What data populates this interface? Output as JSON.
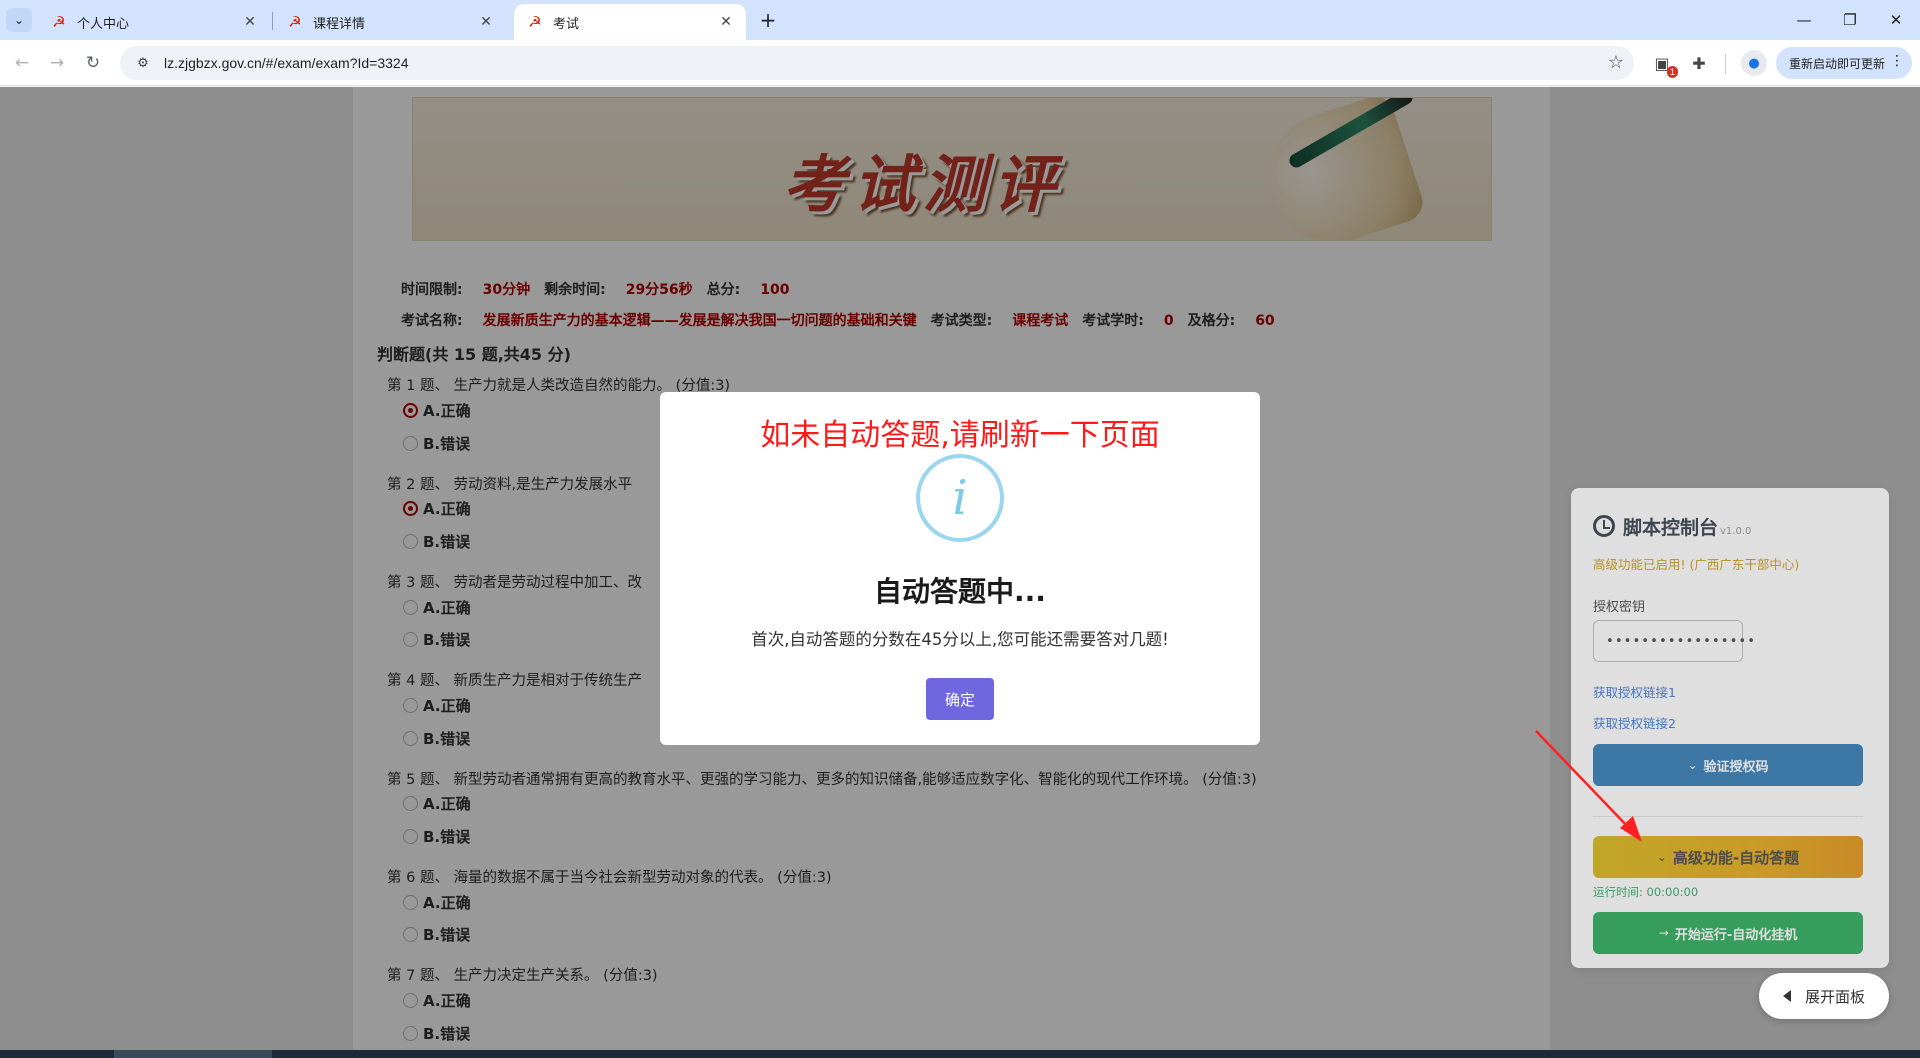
{
  "browser": {
    "tabs": [
      {
        "title": "个人中心",
        "active": false
      },
      {
        "title": "课程详情",
        "active": false
      },
      {
        "title": "考试",
        "active": true
      }
    ],
    "url": "lz.zjgbzx.gov.cn/#/exam/exam?Id=3324",
    "extension_badge": "1",
    "update_label": "重新启动即可更新"
  },
  "exam": {
    "time_limit_label": "时间限制:",
    "time_limit": "30分钟",
    "remaining_label": "剩余时间:",
    "remaining": "29分56秒",
    "total_label": "总分:",
    "total": "100",
    "name_label": "考试名称:",
    "name": "发展新质生产力的基本逻辑——发展是解决我国一切问题的基础和关键",
    "type_label": "考试类型:",
    "type": "课程考试",
    "hours_label": "考试学时:",
    "hours": "0",
    "pass_label": "及格分:",
    "pass": "60",
    "section_title": "判断题(共 15 题,共45 分)",
    "option_a": "A.正确",
    "option_b": "B.错误",
    "questions": [
      {
        "text": "第 1 题、 生产力就是人类改造自然的能力。 (分值:3)",
        "selected": "A"
      },
      {
        "text": "第 2 题、 劳动资料,是生产力发展水平",
        "selected": "A"
      },
      {
        "text": "第 3 题、 劳动者是劳动过程中加工、改",
        "selected": ""
      },
      {
        "text": "第 4 题、 新质生产力是相对于传统生产",
        "selected": ""
      },
      {
        "text": "第 5 题、 新型劳动者通常拥有更高的教育水平、更强的学习能力、更多的知识储备,能够适应数字化、智能化的现代工作环境。 (分值:3)",
        "selected": ""
      },
      {
        "text": "第 6 题、 海量的数据不属于当今社会新型劳动对象的代表。 (分值:3)",
        "selected": ""
      },
      {
        "text": "第 7 题、 生产力决定生产关系。 (分值:3)",
        "selected": ""
      }
    ]
  },
  "modal": {
    "notice": "如未自动答题,请刷新一下页面",
    "icon": "info-icon",
    "title": "自动答题中...",
    "text": "首次,自动答题的分数在45分以上,您可能还需要答对几题!",
    "ok_label": "确定"
  },
  "panel": {
    "title": "脚本控制台",
    "version": "v1.0.0",
    "status": "高级功能已启用! (广西广东干部中心)",
    "key_label": "授权密钥",
    "key_value": "•••••••••••••••••",
    "link1": "获取授权链接1",
    "link2": "获取授权链接2",
    "verify_label": "验证授权码",
    "auto_label": "高级功能-自动答题",
    "runtime": "运行时间: 00:00:00",
    "start_label": "开始运行-自动化挂机",
    "expand_label": "展开面板"
  },
  "colors": {
    "accent_red": "#b30000",
    "modal_button": "#7066e0",
    "notice_red": "#ff1a1a"
  }
}
